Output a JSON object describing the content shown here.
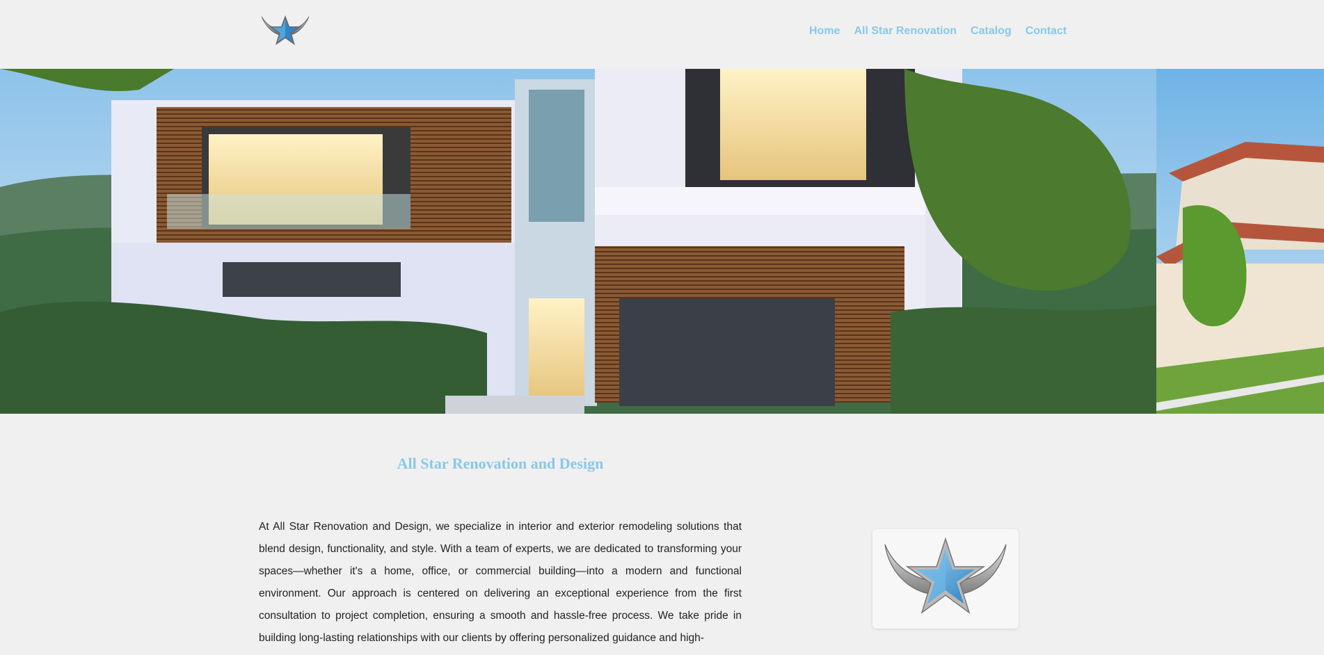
{
  "header": {
    "logo_icon": "winged-star-logo-icon",
    "nav": [
      {
        "label": "Home"
      },
      {
        "label": "All Star Renovation"
      },
      {
        "label": "Catalog"
      },
      {
        "label": "Contact"
      }
    ]
  },
  "hero": {
    "image": "modern-house-hero-image"
  },
  "main": {
    "title": "All Star Renovation and Design",
    "paragraph": "At All Star Renovation and Design, we specialize in interior and exterior remodeling solutions that blend design, functionality, and style. With a team of experts, we are dedicated to transforming your spaces—whether it's a home, office, or commercial building—into a modern and functional environment. Our approach is centered on delivering an exceptional experience from the first consultation to project completion, ensuring a smooth and hassle-free process. We take pride in building long-lasting relationships with our clients by offering personalized guidance and high-",
    "card_icon": "winged-star-logo-icon"
  },
  "colors": {
    "accent": "#88c8e8",
    "background": "#f0f0f0",
    "text": "#222222"
  }
}
